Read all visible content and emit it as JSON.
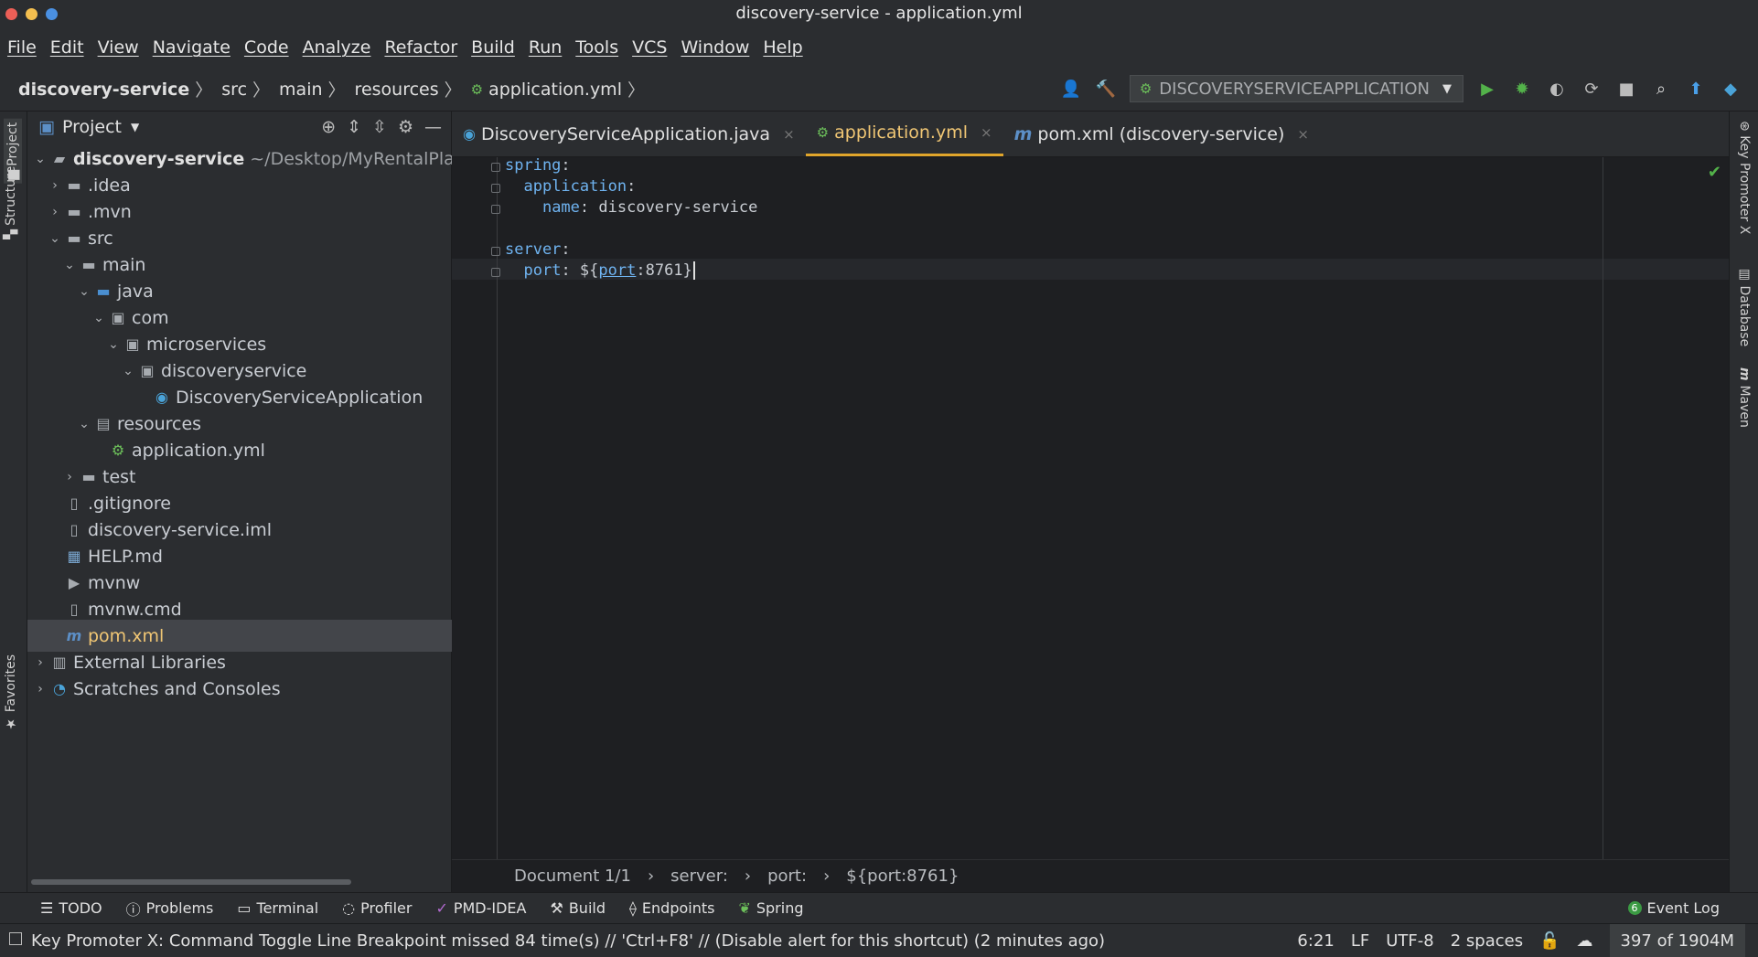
{
  "window": {
    "title": "discovery-service - application.yml"
  },
  "menu": [
    "File",
    "Edit",
    "View",
    "Navigate",
    "Code",
    "Analyze",
    "Refactor",
    "Build",
    "Run",
    "Tools",
    "VCS",
    "Window",
    "Help"
  ],
  "breadcrumb": [
    "discovery-service",
    "src",
    "main",
    "resources",
    "application.yml"
  ],
  "run_config": "DISCOVERYSERVICEAPPLICATION",
  "left_tabs": {
    "project": "Project",
    "structure": "Structure",
    "favorites": "Favorites"
  },
  "right_tabs": {
    "key_promoter": "Key Promoter X",
    "database": "Database",
    "maven": "Maven"
  },
  "project_panel": {
    "title": "Project",
    "root_label": "discovery-service",
    "root_path": "~/Desktop/MyRentalPlatform/",
    "items": [
      {
        "label": ".idea"
      },
      {
        "label": ".mvn"
      },
      {
        "label": "src"
      },
      {
        "label": "main"
      },
      {
        "label": "java"
      },
      {
        "label": "com"
      },
      {
        "label": "microservices"
      },
      {
        "label": "discoveryservice"
      },
      {
        "label": "DiscoveryServiceApplication"
      },
      {
        "label": "resources"
      },
      {
        "label": "application.yml"
      },
      {
        "label": "test"
      },
      {
        "label": ".gitignore"
      },
      {
        "label": "discovery-service.iml"
      },
      {
        "label": "HELP.md"
      },
      {
        "label": "mvnw"
      },
      {
        "label": "mvnw.cmd"
      },
      {
        "label": "pom.xml"
      },
      {
        "label": "External Libraries"
      },
      {
        "label": "Scratches and Consoles"
      }
    ]
  },
  "editor_tabs": [
    {
      "label": "DiscoveryServiceApplication.java"
    },
    {
      "label": "application.yml"
    },
    {
      "label": "pom.xml (discovery-service)"
    }
  ],
  "code": {
    "l1_key": "spring",
    "l2_key": "application",
    "l3_key": "name",
    "l3_val": "discovery-service",
    "l5_key": "server",
    "l6_key": "port",
    "l6_pre": "${",
    "l6_var": "port",
    "l6_post": ":8761}"
  },
  "editor_breadcrumb": [
    "Document 1/1",
    "server:",
    "port:",
    "${port:8761}"
  ],
  "tool_windows": [
    "TODO",
    "Problems",
    "Terminal",
    "Profiler",
    "PMD-IDEA",
    "Build",
    "Endpoints",
    "Spring"
  ],
  "event_log": {
    "label": "Event Log",
    "count": "6"
  },
  "status": {
    "message": "Key Promoter X: Command Toggle Line Breakpoint missed 84 time(s) // 'Ctrl+F8' // (Disable alert for this shortcut) (2 minutes ago)",
    "position": "6:21",
    "line_sep": "LF",
    "encoding": "UTF-8",
    "indent": "2 spaces",
    "memory": "397 of 1904M"
  },
  "colors": {
    "accent_tab": "#e0a52b",
    "yaml_key": "#6fb3f0",
    "run_green": "#53b24a"
  }
}
